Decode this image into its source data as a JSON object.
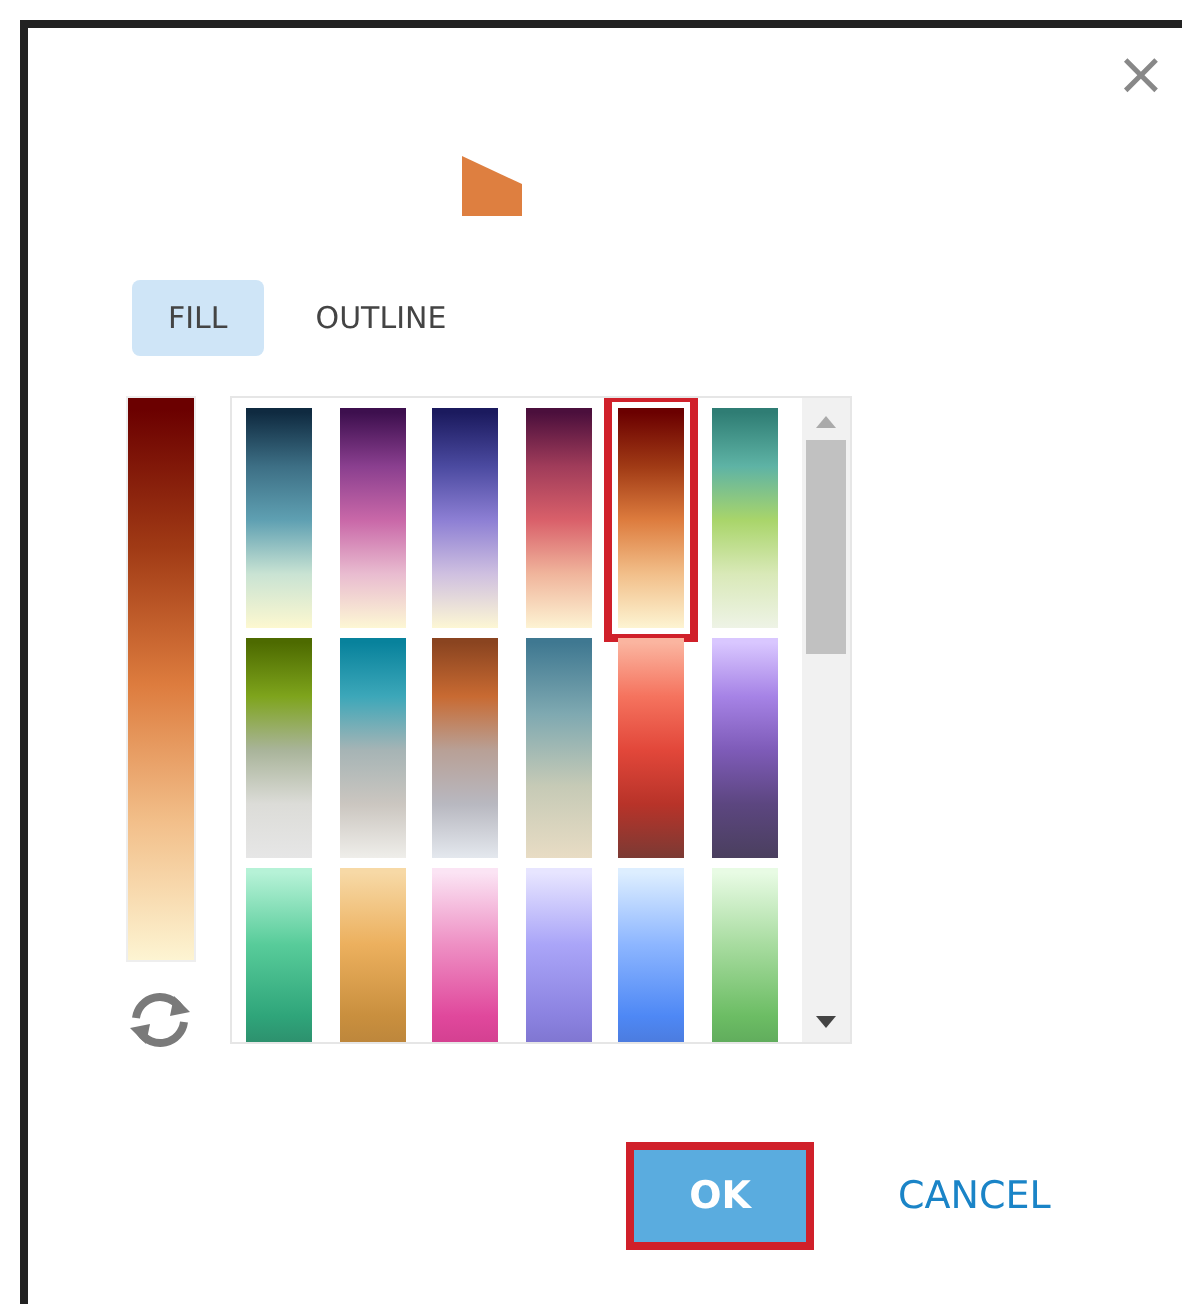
{
  "close": "×",
  "tabs": [
    {
      "label": "FILL",
      "selected": true
    },
    {
      "label": "OUTLINE",
      "selected": false
    }
  ],
  "swatches": [
    {
      "color": "#0f2a40",
      "selected": false
    },
    {
      "color": "#3d0f4e",
      "selected": false
    },
    {
      "color": "#1b1a5e",
      "selected": false
    },
    {
      "color": "#4b0f3c",
      "selected": false
    },
    {
      "color": "#6b0000",
      "selected": true
    },
    {
      "color": "#2f7d74",
      "selected": false
    },
    {
      "color": "#4d6a00",
      "selected": false
    },
    {
      "color": "#08829c",
      "selected": false
    },
    {
      "color": "#8a4420",
      "selected": false
    },
    {
      "color": "#3f7891",
      "selected": false
    },
    {
      "color": "#fbb5a0",
      "selected": false
    },
    {
      "color": "#d9c7ff",
      "selected": false
    },
    {
      "color": "#b6f2d7",
      "selected": false
    },
    {
      "color": "#f7d9a6",
      "selected": false
    },
    {
      "color": "#fbe4f4",
      "selected": false
    },
    {
      "color": "#e7e5ff",
      "selected": false
    },
    {
      "color": "#ddeeff",
      "selected": false
    },
    {
      "color": "#e8fbe4",
      "selected": false
    }
  ],
  "buttons": [
    {
      "label": "OK",
      "kind": "primary",
      "highlighted": true
    },
    {
      "label": "CANCEL",
      "kind": "link",
      "highlighted": false
    }
  ]
}
